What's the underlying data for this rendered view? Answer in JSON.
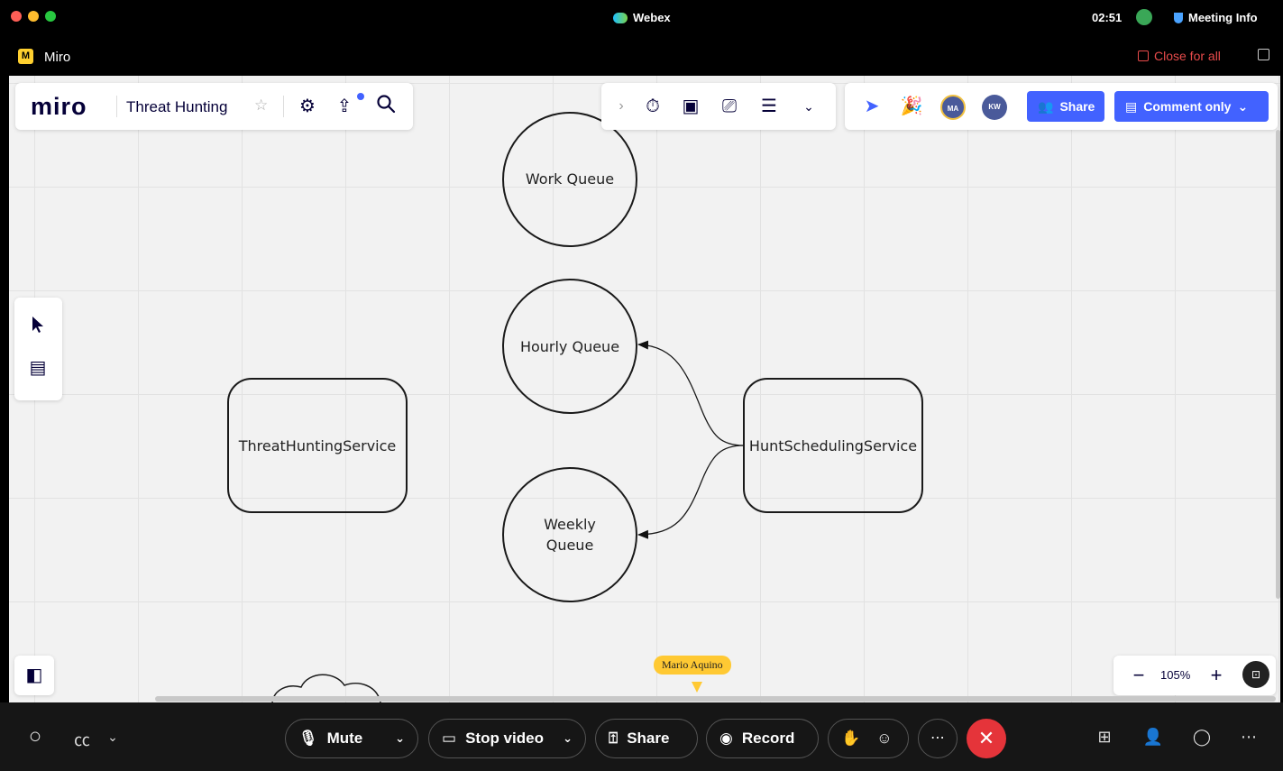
{
  "webex": {
    "title": "Webex",
    "time": "02:51",
    "meeting_info": "Meeting Info",
    "app_name": "Miro",
    "close_for_all": "Close for all",
    "controls": {
      "mute": "Mute",
      "stop_video": "Stop video",
      "share": "Share",
      "record": "Record"
    }
  },
  "miro": {
    "logo": "miro",
    "board_title": "Threat Hunting",
    "share_label": "Share",
    "comment_mode": "Comment only",
    "avatars": [
      {
        "initials": "MA",
        "color": "#4a5a9a"
      },
      {
        "initials": "KW",
        "color": "#4a5a9a"
      }
    ],
    "zoom": "105%",
    "cursor_user": "Mario Aquino"
  },
  "diagram": {
    "nodes": {
      "work_queue": "Work Queue",
      "hourly_queue": "Hourly Queue",
      "weekly_queue_line1": "Weekly",
      "weekly_queue_line2": "Queue",
      "threat_hunting_service": "ThreatHuntingService",
      "hunt_scheduling_service": "HuntSchedulingService"
    }
  },
  "colors": {
    "accent": "#4262ff",
    "cursor": "#ffc933",
    "end_call": "#e5343a"
  }
}
